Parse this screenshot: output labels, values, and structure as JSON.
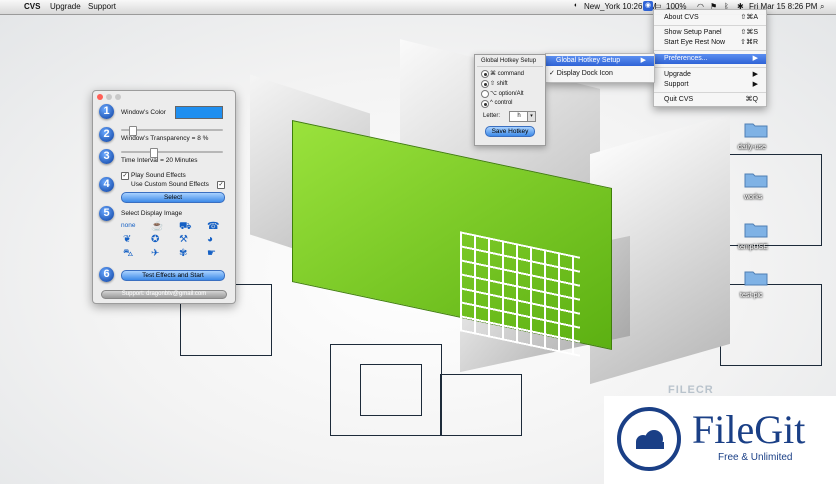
{
  "menubar": {
    "apple": "",
    "app_name": "CVS",
    "items": [
      "Upgrade",
      "Support"
    ],
    "clock_location": "New_York 10:26 PM",
    "battery": "100%",
    "datetime": "Fri Mar 15  8:26 PM"
  },
  "cvs_menu": {
    "items": [
      {
        "label": "About CVS",
        "shortcut": "⇧⌘A"
      },
      {
        "label": "Show Setup Panel",
        "shortcut": "⇧⌘S"
      },
      {
        "label": "Start Eye Rest Now",
        "shortcut": "⇧⌘R"
      },
      {
        "label": "Preferences...",
        "shortcut": "▶"
      },
      {
        "label": "Upgrade",
        "shortcut": "▶"
      },
      {
        "label": "Support",
        "shortcut": "▶"
      },
      {
        "label": "Quit CVS",
        "shortcut": "⌘Q"
      }
    ]
  },
  "prefs_submenu": {
    "items": [
      {
        "label": "Global Hotkey Setup",
        "shortcut": "▶"
      },
      {
        "label": "✓ Display Dock Icon",
        "shortcut": ""
      }
    ]
  },
  "hotkey_panel": {
    "title": "Global Hotkey Setup",
    "options": [
      {
        "label": "⌘ command",
        "selected": true
      },
      {
        "label": "⇧ shift",
        "selected": true
      },
      {
        "label": "⌥ option/Alt",
        "selected": false
      },
      {
        "label": "^ control",
        "selected": true
      }
    ],
    "letter_label": "Letter:",
    "letter_value": "h",
    "save_label": "Save Hotkey"
  },
  "setup_window": {
    "steps": [
      "1",
      "2",
      "3",
      "4",
      "5",
      "6"
    ],
    "color_label": "Window's Color",
    "window_color": "#1f8ff0",
    "transparency_label": "Window's Transparency = 8 %",
    "transparency_percent": 8,
    "interval_label": "Time Interval = 20 Minutes",
    "interval_fraction": 0.3,
    "play_sound_label": "Play Sound Effects",
    "custom_sound_label": "Use Custom Sound Effects",
    "select_label": "Select",
    "display_image_label": "Select Display Image",
    "none_label": "none",
    "image_icons": [
      "cup-icon",
      "cart-icon",
      "drink-icon",
      "phone-icon",
      "bird-icon",
      "fish-icon",
      "star-icon",
      "wrench-icon",
      "eye-icon",
      "car-icon",
      "butterfly-icon",
      "hand-icon",
      "heart-icon"
    ],
    "test_label": "Test Effects and Start",
    "support_label": "Support:   dragonbtv@gmail.com"
  },
  "desktop_folders": [
    "daily-use",
    "works",
    "tempUSE",
    "test-pic"
  ],
  "watermark": {
    "brand": "FileGit",
    "tagline": "Free & Unlimited",
    "faint_text": "FILECR"
  },
  "colors": {
    "accent": "#2f63d6",
    "building_green": "#7ed321"
  }
}
